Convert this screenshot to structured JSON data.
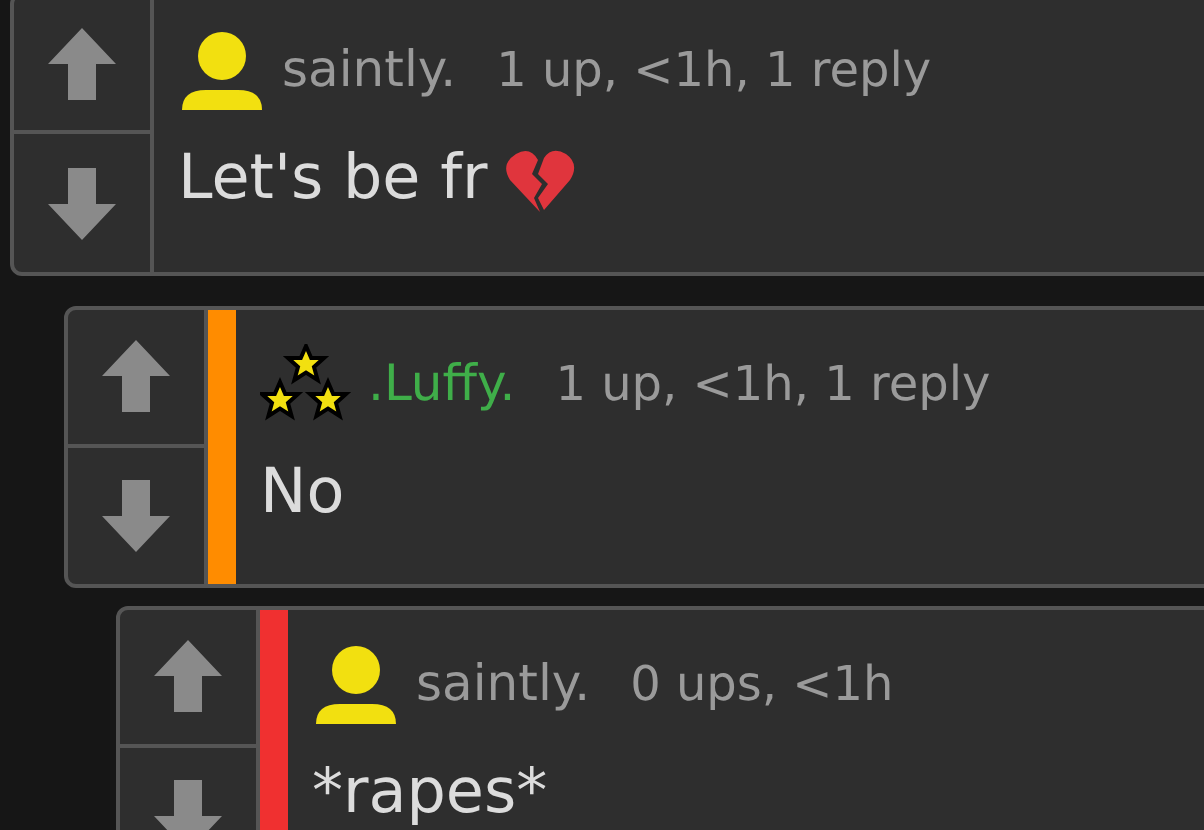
{
  "comments": [
    {
      "kind": "user",
      "username": "saintly.",
      "meta": "1 up, <1h, 1 reply",
      "text": "Let's be fr",
      "emoji": {
        "kind": "broken_heart"
      }
    },
    {
      "kind": "stars",
      "username": ".Luffy.",
      "meta": "1 up, <1h, 1 reply",
      "text": "No",
      "color": "#ff8c00"
    },
    {
      "kind": "user",
      "username": "saintly.",
      "meta": "0 ups, <1h",
      "text": "*rapes*",
      "color": "#f03030"
    }
  ]
}
